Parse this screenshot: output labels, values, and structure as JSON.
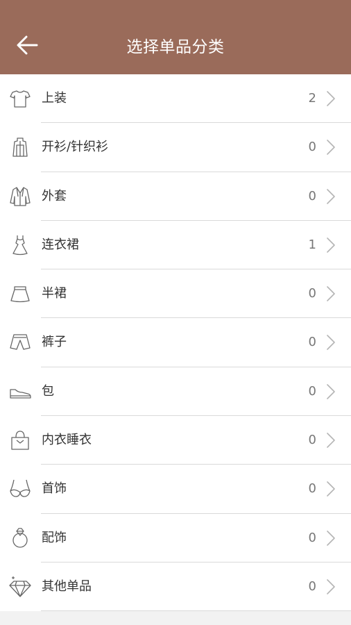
{
  "header": {
    "title": "选择单品分类",
    "back_icon": "arrow-left-icon"
  },
  "colors": {
    "header_bg": "#9a6b5a",
    "text": "#333333",
    "count": "#777777",
    "divider": "#d9d9d9"
  },
  "categories": [
    {
      "label": "上装",
      "count": "2",
      "icon": "tshirt-icon"
    },
    {
      "label": "开衫/针织衫",
      "count": "0",
      "icon": "cardigan-icon"
    },
    {
      "label": "外套",
      "count": "0",
      "icon": "coat-icon"
    },
    {
      "label": "连衣裙",
      "count": "1",
      "icon": "dress-icon"
    },
    {
      "label": "半裙",
      "count": "0",
      "icon": "skirt-icon"
    },
    {
      "label": "裤子",
      "count": "0",
      "icon": "pants-icon"
    },
    {
      "label": "包",
      "count": "0",
      "icon": "shoe-icon"
    },
    {
      "label": "内衣睡衣",
      "count": "0",
      "icon": "handbag-icon"
    },
    {
      "label": "首饰",
      "count": "0",
      "icon": "bra-icon"
    },
    {
      "label": "配饰",
      "count": "0",
      "icon": "diamond-ring-icon"
    },
    {
      "label": "其他单品",
      "count": "0",
      "icon": "diamond-icon"
    }
  ]
}
